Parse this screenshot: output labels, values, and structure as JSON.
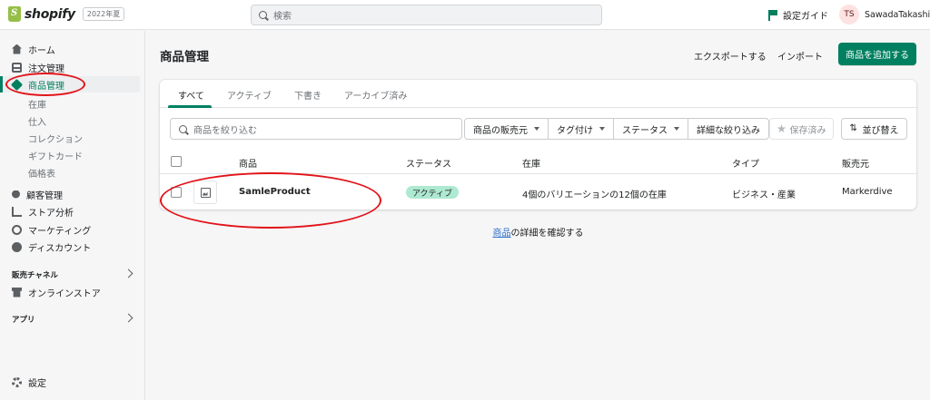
{
  "topbar": {
    "brand": "shopify",
    "edition_badge": "2022年夏",
    "search_placeholder": "検索",
    "guide_label": "設定ガイド",
    "user_initials": "TS",
    "user_name": "SawadaTakashi"
  },
  "sidebar": {
    "items": [
      {
        "label": "ホーム",
        "icon": "home-icon"
      },
      {
        "label": "注文管理",
        "icon": "orders-icon"
      },
      {
        "label": "商品管理",
        "icon": "tag-icon",
        "active": true
      },
      {
        "label": "顧客管理",
        "icon": "customers-icon"
      },
      {
        "label": "ストア分析",
        "icon": "analytics-icon"
      },
      {
        "label": "マーケティング",
        "icon": "marketing-icon"
      },
      {
        "label": "ディスカウント",
        "icon": "discount-icon"
      }
    ],
    "product_subitems": [
      "在庫",
      "仕入",
      "コレクション",
      "ギフトカード",
      "価格表"
    ],
    "sales_channels_label": "販売チャネル",
    "online_store_label": "オンラインストア",
    "apps_label": "アプリ",
    "settings_label": "設定"
  },
  "header": {
    "title": "商品管理",
    "export_label": "エクスポートする",
    "import_label": "インポート",
    "add_product_label": "商品を追加する"
  },
  "tabs": [
    "すべて",
    "アクティブ",
    "下書き",
    "アーカイブ済み"
  ],
  "filters": {
    "search_placeholder": "商品を絞り込む",
    "sales_channel": "商品の販売元",
    "tagged": "タグ付け",
    "status": "ステータス",
    "more_filters": "詳細な絞り込み",
    "saved": "保存済み",
    "sort": "並び替え"
  },
  "table": {
    "columns": [
      "商品",
      "ステータス",
      "在庫",
      "タイプ",
      "販売元"
    ],
    "rows": [
      {
        "product": "SamleProduct",
        "status": "アクティブ",
        "inventory": "4個のバリエーションの12個の在庫",
        "type": "ビジネス・産業",
        "vendor": "Markerdive"
      }
    ]
  },
  "footer": {
    "link_text": "商品",
    "suffix": "の詳細を確認する"
  },
  "colors": {
    "primary": "#008060",
    "annotation": "#e2141a",
    "badge_success": "#aee9d1",
    "link": "#2c6ecb"
  }
}
